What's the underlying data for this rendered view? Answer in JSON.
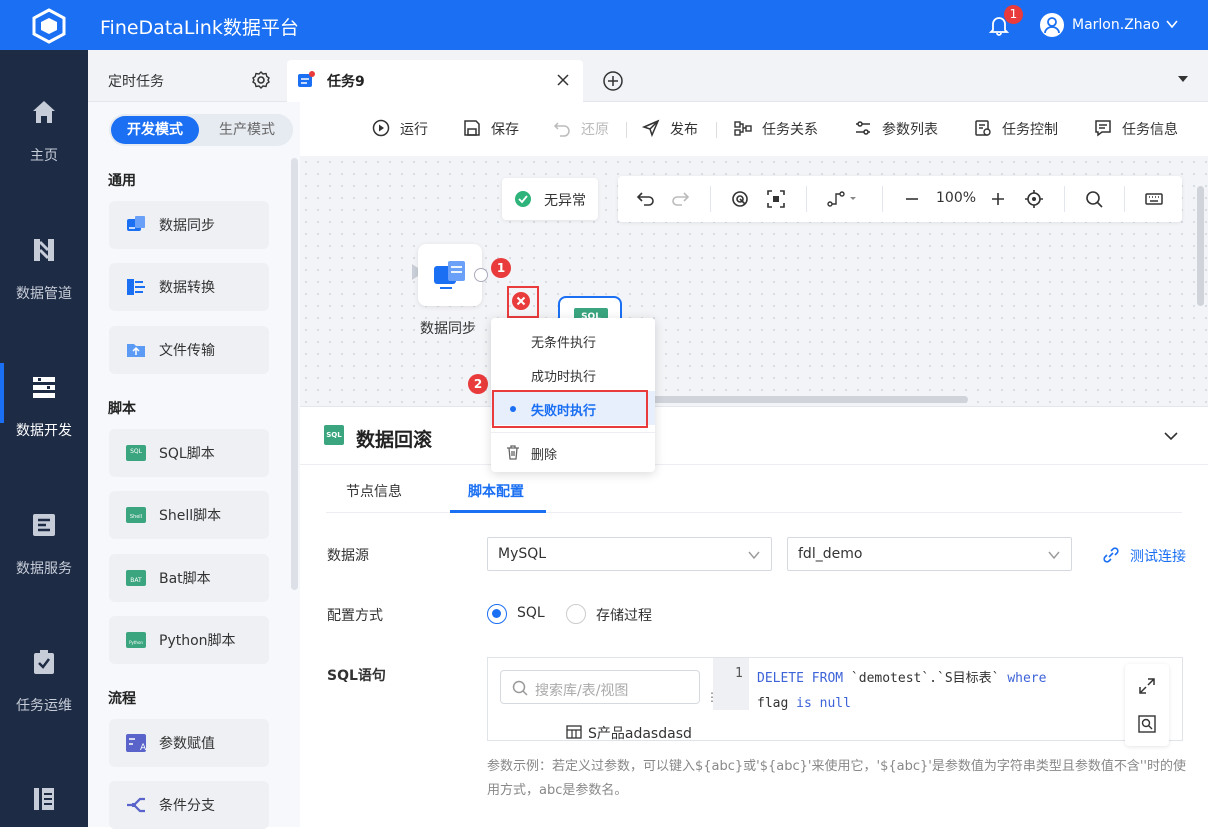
{
  "app": {
    "title": "FineDataLink数据平台",
    "notification_count": "1",
    "user": "Marlon.Zhao"
  },
  "nav": {
    "items": [
      {
        "id": "home",
        "label": "主页"
      },
      {
        "id": "pipeline",
        "label": "数据管道"
      },
      {
        "id": "dev",
        "label": "数据开发",
        "active": true
      },
      {
        "id": "service",
        "label": "数据服务"
      },
      {
        "id": "ops",
        "label": "任务运维"
      }
    ]
  },
  "tabs": {
    "scheduled": "定时任务",
    "current": "任务9"
  },
  "palette": {
    "mode_dev": "开发模式",
    "mode_prod": "生产模式",
    "sections": {
      "general": "通用",
      "script": "脚本",
      "flow": "流程"
    },
    "general": [
      "数据同步",
      "数据转换",
      "文件传输"
    ],
    "script": [
      "SQL脚本",
      "Shell脚本",
      "Bat脚本",
      "Python脚本"
    ],
    "flow": [
      "参数赋值",
      "条件分支"
    ]
  },
  "toolbar": {
    "run": "运行",
    "save": "保存",
    "restore": "还原",
    "publish": "发布",
    "relation": "任务关系",
    "params": "参数列表",
    "control": "任务控制",
    "info": "任务信息"
  },
  "canvas": {
    "status": "无异常",
    "zoom": "100%",
    "node_sync_label": "数据同步",
    "node_sql_icon": "SQL",
    "marker1": "1",
    "marker2": "2"
  },
  "context_menu": {
    "items": [
      "无条件执行",
      "成功时执行",
      "失败时执行"
    ],
    "selected": "失败时执行",
    "delete": "删除"
  },
  "panel": {
    "title": "数据回滚",
    "icon_text": "SQL",
    "tabs": [
      "节点信息",
      "脚本配置"
    ],
    "active_tab": "脚本配置",
    "datasource_label": "数据源",
    "datasource_type": "MySQL",
    "datasource_db": "fdl_demo",
    "test_link": "测试连接",
    "config_label": "配置方式",
    "config_sql": "SQL",
    "config_proc": "存储过程",
    "sql_label": "SQL语句",
    "search_placeholder": "搜索库/表/视图",
    "tree_item": "S产品adasdasd",
    "line_no": "1",
    "code_line1_a": "DELETE FROM",
    "code_line1_b": " `demotest`.`S目标表` ",
    "code_line1_c": "where",
    "code_line2_a": "flag ",
    "code_line2_b": "is null",
    "hint": "参数示例：若定义过参数，可以键入${abc}或'${abc}'来使用它，'${abc}'是参数值为字符串类型且参数值不含''时的使用方式，abc是参数名。"
  },
  "colors": {
    "brand": "#1a6ff2",
    "nav_bg": "#1d2b45",
    "alert": "#e93b3b",
    "sql_green": "#3aa57f"
  }
}
